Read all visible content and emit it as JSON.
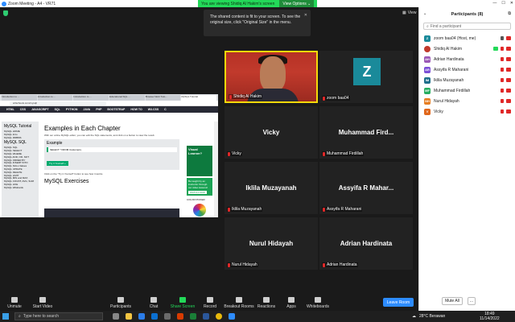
{
  "titlebar": {
    "app_title": "Zoom Meeting - A4 - VR71",
    "banner": "You are viewing Shidiq Al Hakim's screen",
    "view_options": "View Options ⌄",
    "minimize": "—",
    "maximize": "☐",
    "close": "✕"
  },
  "meeting": {
    "view_label": "View",
    "toast_text": "The shared content is fit to your screen. To see the original size, click \"Original Size\" in the menu.",
    "toast_close": "✕"
  },
  "shared_screen": {
    "tabs": [
      "Introduction to ...",
      "Introduction to ...",
      "Introduction to ...",
      "Educational SQL ...",
      "Browser Web Tuto...",
      "MySQL Tutorial"
    ],
    "url": "w3schools.com/mysql/",
    "nav": [
      "HTML",
      "CSS",
      "JAVASCRIPT",
      "SQL",
      "PYTHON",
      "JAVA",
      "PHP",
      "BOOTSTRAP",
      "HOW TO",
      "W3.CSS",
      "C"
    ],
    "sidebar_title": "MySQL Tutorial",
    "sidebar_items_a": [
      "MySQL HOME",
      "MySQL Intro",
      "MySQL RDBMS"
    ],
    "sidebar_title_2": "MySQL SQL",
    "sidebar_items_b": [
      "MySQL SQL",
      "MySQL SELECT",
      "MySQL WHERE",
      "MySQL AND, OR, NOT",
      "MySQL ORDER BY",
      "MySQL INSERT INTO",
      "MySQL NULL Values",
      "MySQL UPDATE",
      "MySQL DELETE",
      "MySQL LIMIT",
      "MySQL MIN and MAX",
      "MySQL COUNT, AVG, SUM",
      "MySQL LIKE",
      "MySQL Wildcards"
    ],
    "heading": "Examples in Each Chapter",
    "intro": "With our online MySQL editor, you can edit the SQL statements, and click on a button to view the result.",
    "example_title": "Example",
    "example_code": "SELECT * FROM Customers;",
    "try_button": "Try it Yourself »",
    "try_hint": "Click on the \"Try it Yourself\" button to see how it works.",
    "exercises_heading": "MySQL Exercises",
    "ad_title": "Visual Learner?",
    "ad_body": "Be taught by an instructor through our video lessons!",
    "ad_button": "WATCH NOW",
    "color_picker": "COLOR PICKER"
  },
  "tiles": [
    {
      "name": "",
      "label": "Shidiq Al Hakim",
      "type": "camera"
    },
    {
      "name": "Z",
      "label": "zoom baa04",
      "type": "avatar"
    },
    {
      "name": "Vicky",
      "label": "Vicky",
      "type": "name"
    },
    {
      "name": "Muhammad  Fird...",
      "label": "Muhammad Firdillah",
      "type": "name"
    },
    {
      "name": "Iklila Muzayanah",
      "label": "Iklila Muzayanah",
      "type": "name"
    },
    {
      "name": "Assyifa  R  Mahar...",
      "label": "Assyifa R Maharani",
      "type": "name"
    },
    {
      "name": "Nurul Hidayah",
      "label": "Nurul Hidayah",
      "type": "name"
    },
    {
      "name": "Adrian Hardinata",
      "label": "Adrian Hardinata",
      "type": "name"
    }
  ],
  "toolbar": {
    "unmute": "Unmute",
    "start_video": "Start Video",
    "participants": "Participants",
    "participants_count": "8",
    "chat": "Chat",
    "share_screen": "Share Screen",
    "record": "Record",
    "breakout": "Breakout Rooms",
    "reactions": "Reactions",
    "apps": "Apps",
    "whiteboards": "Whiteboards",
    "leave": "Leave Room"
  },
  "panel": {
    "title": "Participants (8)",
    "chevron": "⌄",
    "minimize": "⧉",
    "find_placeholder": "Find a participant",
    "participants": [
      {
        "initials": "Z",
        "name": "zoom baa04 (Host, me)",
        "color": "#1a8a9a"
      },
      {
        "initials": "",
        "name": "Shidiq Al Hakim",
        "color": "#c0392b"
      },
      {
        "initials": "AH",
        "name": "Adrian Hardinata",
        "color": "#9b59b6"
      },
      {
        "initials": "AR",
        "name": "Assyifa R Maharani",
        "color": "#7b4fd6"
      },
      {
        "initials": "IM",
        "name": "Iklila Muzayanah",
        "color": "#1f6f8b"
      },
      {
        "initials": "MF",
        "name": "Muhammad Firdillah",
        "color": "#27ae60"
      },
      {
        "initials": "NH",
        "name": "Nurul Hidayah",
        "color": "#e67e22"
      },
      {
        "initials": "V",
        "name": "Vicky",
        "color": "#e0671b"
      }
    ],
    "mute_all": "Mute All",
    "more": "..."
  },
  "taskbar": {
    "search_placeholder": "Type here to search",
    "weather": "28°C  Berawan",
    "time": "18:49",
    "date": "11/14/2022"
  },
  "colors": {
    "zoom_blue": "#2d8cff",
    "banner_green": "#23d959",
    "mic_red": "#e02828",
    "speaker_yellow": "#f5d90a"
  }
}
